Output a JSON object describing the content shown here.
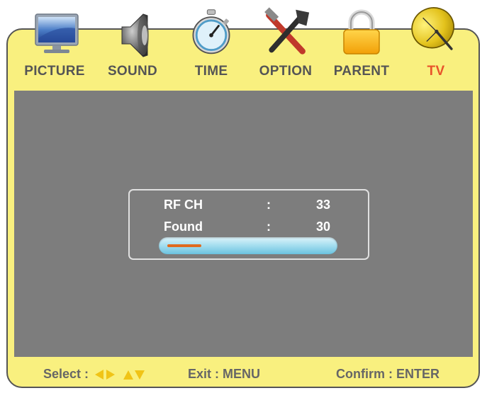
{
  "menu": {
    "tabs": [
      {
        "label": "PICTURE",
        "icon": "monitor-icon"
      },
      {
        "label": "SOUND",
        "icon": "speaker-icon"
      },
      {
        "label": "TIME",
        "icon": "stopwatch-icon"
      },
      {
        "label": "OPTION",
        "icon": "tools-icon"
      },
      {
        "label": "PARENT",
        "icon": "padlock-icon"
      },
      {
        "label": "TV",
        "icon": "satellite-dish-icon"
      }
    ],
    "active_tab": "TV"
  },
  "scan": {
    "rf_label": "RF CH",
    "rf_sep": ":",
    "rf_value": "33",
    "found_label": "Found",
    "found_sep": ":",
    "found_value": "30",
    "progress_fraction": 0.21
  },
  "footer": {
    "select_label": "Select :",
    "exit_label": "Exit : MENU",
    "confirm_label": "Confirm : ENTER"
  },
  "colors": {
    "panel": "#f9f07f",
    "content": "#7d7d7d",
    "active_tab": "#e8542b",
    "arrow_keys": "#f0c417",
    "progress_fill": "#e06a1e"
  }
}
